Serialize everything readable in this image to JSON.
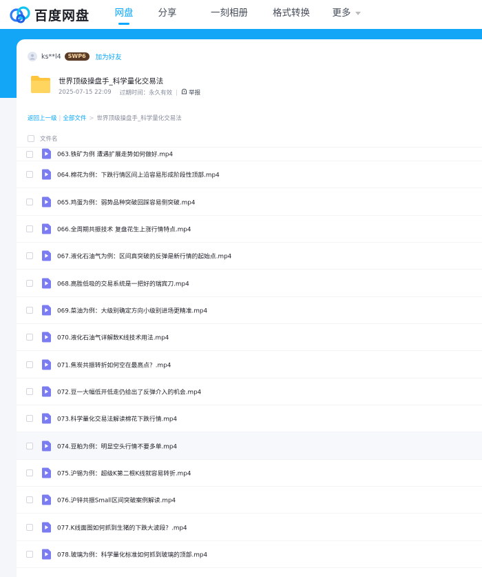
{
  "brand": {
    "name": "百度网盘"
  },
  "nav": [
    {
      "label": "网盘",
      "active": true
    },
    {
      "label": "分享",
      "active": false
    },
    {
      "label": "一刻相册",
      "active": false
    },
    {
      "label": "格式转换",
      "active": false
    },
    {
      "label": "更多",
      "active": false,
      "dropdown": true
    }
  ],
  "sharer": {
    "name": "ks**l4",
    "badge": "SWP6",
    "add_friend": "加为好友"
  },
  "share": {
    "title": "世界顶级操盘手_科学量化交易法",
    "date": "2025-07-15 22:09",
    "expire_label": "过期时间：",
    "expire_value": "永久有效",
    "report": "举报"
  },
  "breadcrumb": {
    "back": "返回上一级",
    "all": "全部文件",
    "current": "世界顶级操盘手_科学量化交易法"
  },
  "table": {
    "header": "文件名",
    "rows": [
      "063.铁矿为例 遭遇扩展走势如何做好.mp4",
      "064.棉花为例：下跌行情区间上沿容易形成阶段性顶部.mp4",
      "065.鸡蛋为例：弱势品种突破回踩容易侧突破.mp4",
      "066.全周期共振技术 复盘花生上涨行情特点.mp4",
      "067.液化石油气为例：区间真突破的反弹是新行情的起始点.mp4",
      "068.高胜低吸的交易系统是一把好的瑞宾刀.mp4",
      "069.菜油为例：大级别确定方向小级别进场更精准.mp4",
      "070.液化石油气详解数K线技术用法.mp4",
      "071.焦炭共振转折如何空在最高点？.mp4",
      "072.豆一大幅低开低走仍给出了反弹介入的机会.mp4",
      "073.科学量化交易法解读棉花下跌行情.mp4",
      "074.豆粕为例：明显空头行情不要多单.mp4",
      "075.沪锡为例：超级K第二根K线就容易转折.mp4",
      "076.沪锌共振Small区间突破案例解读.mp4",
      "077.K线面图如何抓到生猪的下跌大波段？.mp4",
      "078.玻璃为例：科学量化标准如何抓到玻璃的顶部.mp4"
    ],
    "highlight_row": 11
  },
  "colors": {
    "accent": "#06a7ff",
    "band": "#13a6f7",
    "video_icon": "#7b7bf2"
  },
  "icons": [
    "baidu-cloud-logo-icon",
    "folder-icon",
    "video-file-icon",
    "report-icon",
    "chevron-down-icon",
    "avatar-icon"
  ]
}
